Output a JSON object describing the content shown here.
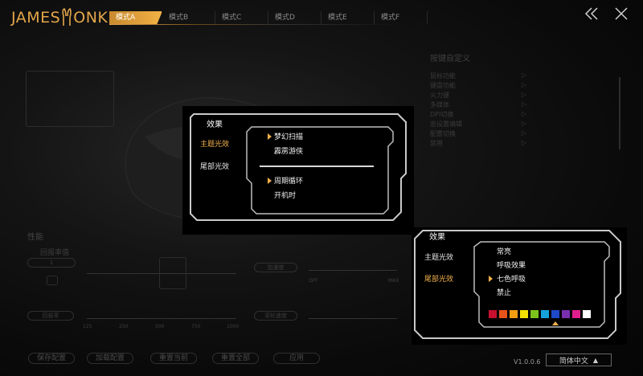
{
  "header": {
    "logo_left": "JAMES",
    "logo_right": "ONKEY",
    "tabs": [
      {
        "label": "模式A",
        "active": true
      },
      {
        "label": "模式B",
        "active": false
      },
      {
        "label": "模式C",
        "active": false
      },
      {
        "label": "模式D",
        "active": false
      },
      {
        "label": "模式E",
        "active": false
      },
      {
        "label": "模式F",
        "active": false
      }
    ],
    "collapse_icon": "double-chevron-left-icon",
    "close_icon": "close-icon"
  },
  "side_panel": {
    "title": "按键自定义",
    "items": [
      "鼠标功能",
      "键盘功能",
      "火力键",
      "多媒体",
      "DPI切换",
      "宏设置编辑",
      "配置切换",
      "禁用"
    ]
  },
  "performance": {
    "title": "性能",
    "dpi_label": "回报率值",
    "dpi_value": "1",
    "polling_label": "加速度",
    "report_label": "回报率",
    "scroll_label": "滚轮速度",
    "polling_ticks": [
      "125",
      "250",
      "500",
      "750",
      "1000"
    ],
    "off_label": "OFF",
    "max_label": "MAX"
  },
  "main_popup": {
    "title": "效果",
    "categories": [
      {
        "label": "主题光效",
        "active": true
      },
      {
        "label": "尾部光效",
        "active": false
      }
    ],
    "group1": [
      {
        "label": "梦幻扫描",
        "selected": true
      },
      {
        "label": "霹雳游侠",
        "selected": false
      }
    ],
    "group2": [
      {
        "label": "周期循环",
        "selected": true
      },
      {
        "label": "开机时",
        "selected": false
      }
    ]
  },
  "tail_popup": {
    "title": "效果",
    "categories": [
      {
        "label": "主题光效",
        "active": false
      },
      {
        "label": "尾部光效",
        "active": true
      }
    ],
    "options": [
      {
        "label": "常亮",
        "selected": false
      },
      {
        "label": "呼吸效果",
        "selected": false
      },
      {
        "label": "七色呼吸",
        "selected": true
      },
      {
        "label": "禁止",
        "selected": false
      }
    ],
    "colors": [
      "#c8102e",
      "#e8531b",
      "#f29d12",
      "#f2e205",
      "#7cc41c",
      "#16a3dc",
      "#1e49c8",
      "#7a2fb0",
      "#e21e8c",
      "#ffffff"
    ],
    "selected_color_index": 6
  },
  "footer": {
    "buttons": [
      "保存配置",
      "加载配置",
      "重置当前",
      "重置全部",
      "应用"
    ],
    "version": "V1.0.0.6",
    "language": "简体中文",
    "language_icon": "triangle-up-icon"
  }
}
